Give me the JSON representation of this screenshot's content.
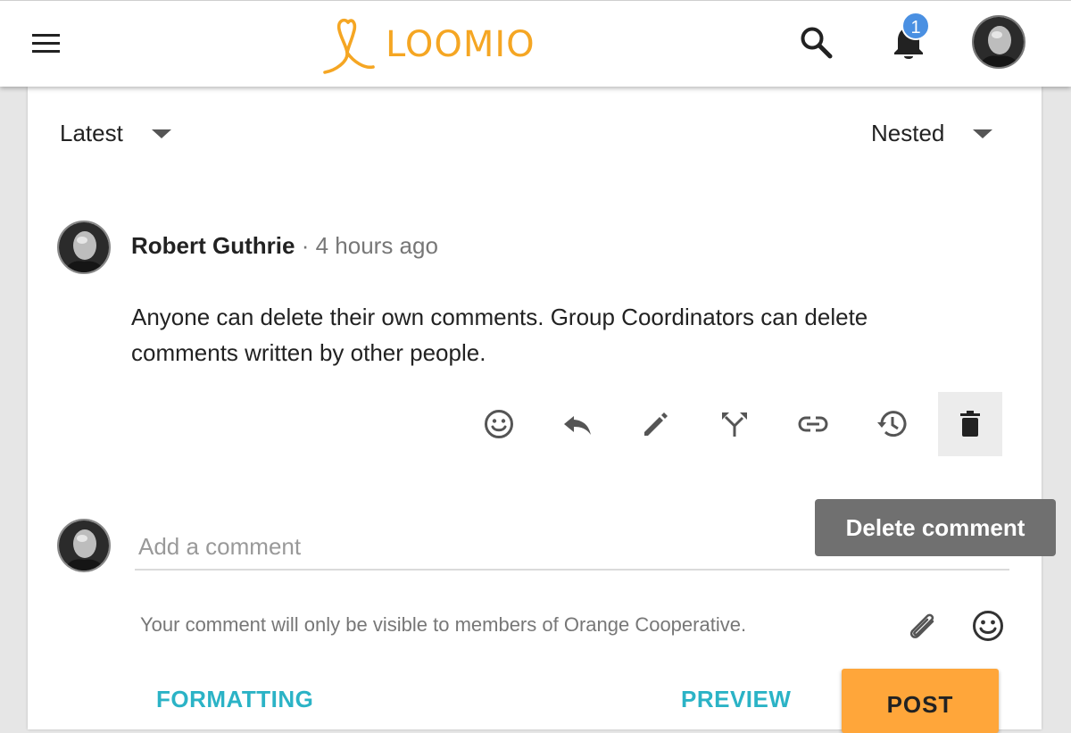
{
  "colors": {
    "brand_orange": "#f5a623",
    "accent_teal": "#2bb3c6",
    "badge_blue": "#4a90e2",
    "post_button": "#ffa63a",
    "tooltip_bg": "#707070"
  },
  "header": {
    "menu_icon": "menu-icon",
    "logo_text": "LOOMIO",
    "search_icon": "search-icon",
    "notifications_icon": "bell-icon",
    "notification_count": "1",
    "avatar_icon": "user-avatar"
  },
  "sort": {
    "order": "Latest",
    "view": "Nested"
  },
  "comment": {
    "author": "Robert Guthrie",
    "separator": "·",
    "time": "4 hours ago",
    "body": "Anyone can delete their own comments. Group Coordinators can delete comments written by other people.",
    "actions": [
      "smile-icon",
      "reply-icon",
      "edit-icon",
      "fork-icon",
      "link-icon",
      "history-icon",
      "delete-icon"
    ]
  },
  "tooltip": {
    "text": "Delete comment"
  },
  "new_comment": {
    "placeholder": "Add a comment",
    "visibility_note": "Your comment will only be visible to members of Orange Cooperative.",
    "attach_icon": "paperclip-icon",
    "emoji_icon": "smile-icon",
    "formatting_label": "FORMATTING",
    "preview_label": "PREVIEW",
    "post_label": "POST"
  }
}
